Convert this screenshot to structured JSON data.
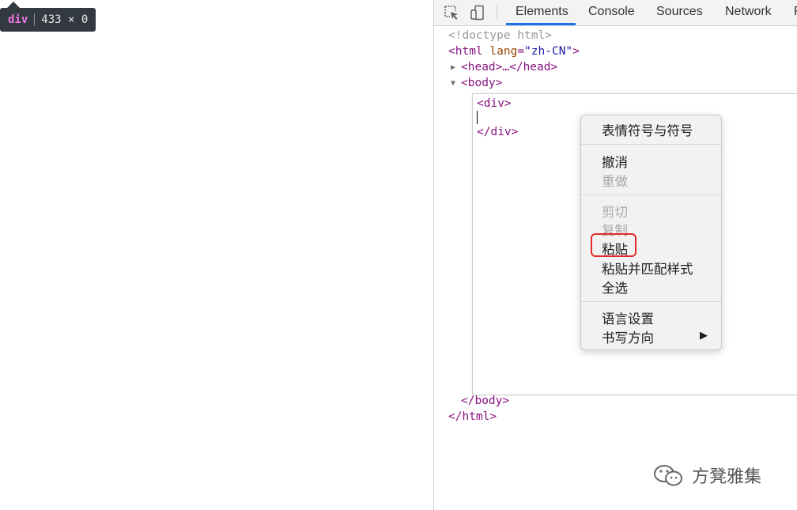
{
  "tooltip": {
    "tag": "div",
    "size": "433 × 0"
  },
  "devtools": {
    "tabs": [
      "Elements",
      "Console",
      "Sources",
      "Network",
      "P"
    ],
    "active_tab": "Elements"
  },
  "dom": {
    "doctype": "<!doctype html>",
    "html_open": "<html",
    "html_attr": "lang",
    "html_attr_value": "\"zh-CN\"",
    "html_gt": ">",
    "head": "<head>…</head>",
    "body_open": "<body>",
    "div_open": "<div>",
    "div_close": "</div>",
    "body_close": "</body>",
    "html_close": "</html>"
  },
  "context_menu": {
    "emoji": "表情符号与符号",
    "undo": "撤消",
    "redo": "重做",
    "cut": "剪切",
    "copy": "复制",
    "paste": "粘贴",
    "paste_match": "粘贴并匹配样式",
    "select_all": "全选",
    "language": "语言设置",
    "writing_direction": "书写方向",
    "submenu_arrow": "▶"
  },
  "watermark": {
    "text": "方凳雅集"
  }
}
